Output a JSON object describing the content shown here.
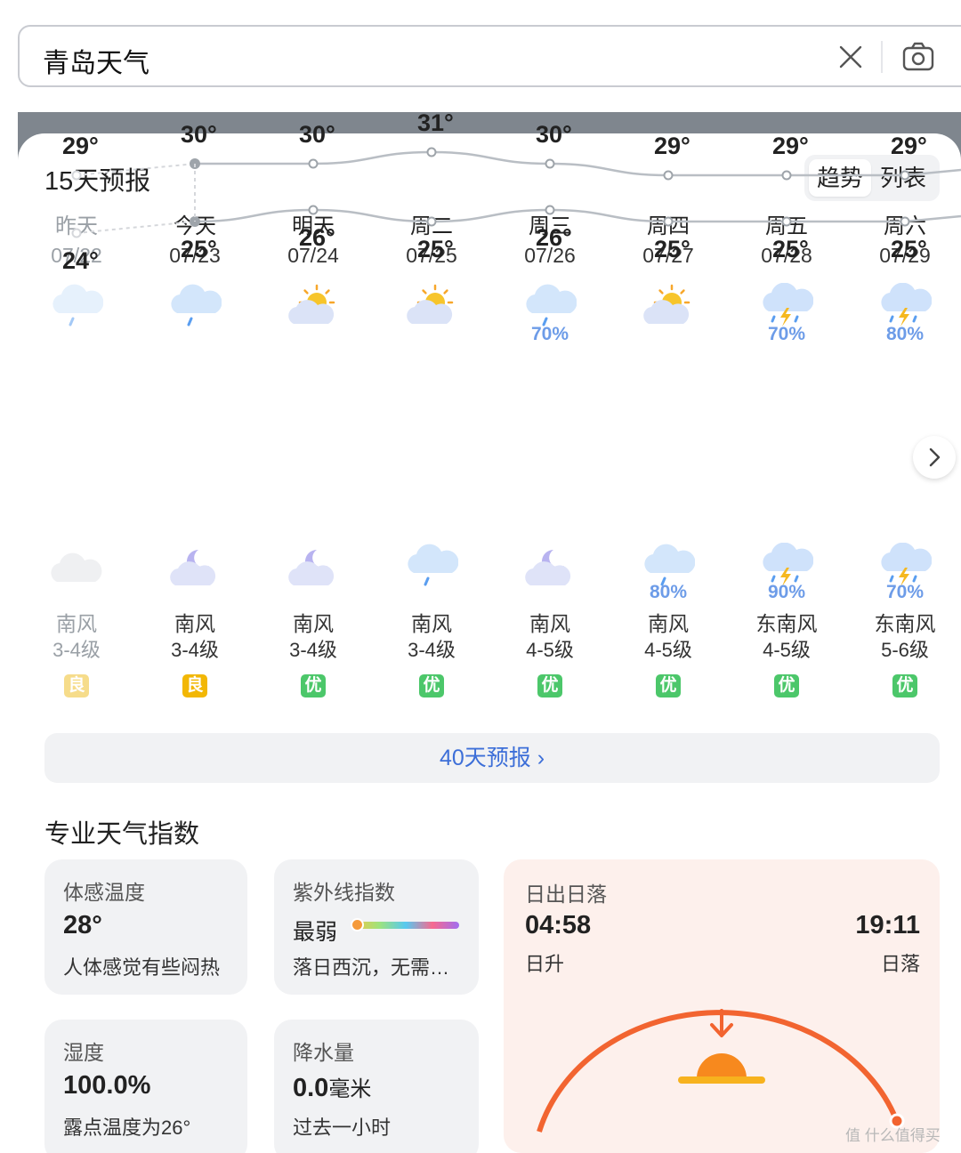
{
  "search": {
    "query": "青岛天气"
  },
  "forecast": {
    "title": "15天预报",
    "view_toggle": {
      "trend": "趋势",
      "list": "列表"
    },
    "days": [
      {
        "name": "昨天",
        "date": "07/22",
        "day_icon": "rain-icon",
        "day_precip": "",
        "high": "29°",
        "low": "24°",
        "night_icon": "cloudy-icon",
        "night_precip": "",
        "wind_dir": "南风",
        "wind_level": "3-4级",
        "aqi": "良",
        "aqi_level": "moderate"
      },
      {
        "name": "今天",
        "date": "07/23",
        "day_icon": "rain-icon",
        "day_precip": "",
        "high": "30°",
        "low": "25°",
        "night_icon": "moon-cloud-icon",
        "night_precip": "",
        "wind_dir": "南风",
        "wind_level": "3-4级",
        "aqi": "良",
        "aqi_level": "moderate"
      },
      {
        "name": "明天",
        "date": "07/24",
        "day_icon": "partly-sunny-icon",
        "day_precip": "",
        "high": "30°",
        "low": "26°",
        "night_icon": "moon-cloud-icon",
        "night_precip": "",
        "wind_dir": "南风",
        "wind_level": "3-4级",
        "aqi": "优",
        "aqi_level": "good"
      },
      {
        "name": "周二",
        "date": "07/25",
        "day_icon": "partly-sunny-icon",
        "day_precip": "",
        "high": "31°",
        "low": "25°",
        "night_icon": "rain-icon",
        "night_precip": "",
        "wind_dir": "南风",
        "wind_level": "3-4级",
        "aqi": "优",
        "aqi_level": "good"
      },
      {
        "name": "周三",
        "date": "07/26",
        "day_icon": "rain-icon",
        "day_precip": "70%",
        "high": "30°",
        "low": "26°",
        "night_icon": "moon-cloud-icon",
        "night_precip": "",
        "wind_dir": "南风",
        "wind_level": "4-5级",
        "aqi": "优",
        "aqi_level": "good"
      },
      {
        "name": "周四",
        "date": "07/27",
        "day_icon": "partly-sunny-icon",
        "day_precip": "",
        "high": "29°",
        "low": "25°",
        "night_icon": "rain-icon",
        "night_precip": "80%",
        "wind_dir": "南风",
        "wind_level": "4-5级",
        "aqi": "优",
        "aqi_level": "good"
      },
      {
        "name": "周五",
        "date": "07/28",
        "day_icon": "thunderstorm-icon",
        "day_precip": "70%",
        "high": "29°",
        "low": "25°",
        "night_icon": "thunderstorm-icon",
        "night_precip": "90%",
        "wind_dir": "东南风",
        "wind_level": "4-5级",
        "aqi": "优",
        "aqi_level": "good"
      },
      {
        "name": "周六",
        "date": "07/29",
        "day_icon": "thunderstorm-icon",
        "day_precip": "80%",
        "high": "29°",
        "low": "25°",
        "night_icon": "thunderstorm-icon",
        "night_precip": "70%",
        "wind_dir": "东南风",
        "wind_level": "5-6级",
        "aqi": "优",
        "aqi_level": "good"
      }
    ],
    "more_label": "40天预报 ›"
  },
  "chart_data": {
    "type": "line",
    "categories": [
      "07/22",
      "07/23",
      "07/24",
      "07/25",
      "07/26",
      "07/27",
      "07/28",
      "07/29"
    ],
    "series": [
      {
        "values": [
          29,
          30,
          30,
          31,
          30,
          29,
          29,
          29
        ]
      },
      {
        "values": [
          24,
          25,
          26,
          25,
          26,
          25,
          25,
          25
        ]
      }
    ],
    "title": "",
    "xlabel": "",
    "ylabel": ""
  },
  "indices": {
    "title": "专业天气指数",
    "feels_like": {
      "title": "体感温度",
      "value": "28°",
      "desc": "人体感觉有些闷热"
    },
    "uv": {
      "title": "紫外线指数",
      "value": "最弱",
      "desc": "落日西沉，无需…"
    },
    "sun": {
      "title": "日出日落",
      "sunrise": "04:58",
      "sunrise_label": "日升",
      "sunset": "19:11",
      "sunset_label": "日落"
    },
    "humidity": {
      "title": "湿度",
      "value": "100.0%",
      "desc": "露点温度为26°"
    },
    "precip": {
      "title": "降水量",
      "value": "0.0",
      "unit": "毫米",
      "desc": "过去一小时"
    }
  },
  "watermark": "值 什么值得买",
  "colors": {
    "accent_blue": "#3d6fd8",
    "precip_blue": "#6d9ce8",
    "aqi_good": "#4cc76a",
    "aqi_moderate": "#f2b705",
    "sun_orange": "#f26430"
  }
}
